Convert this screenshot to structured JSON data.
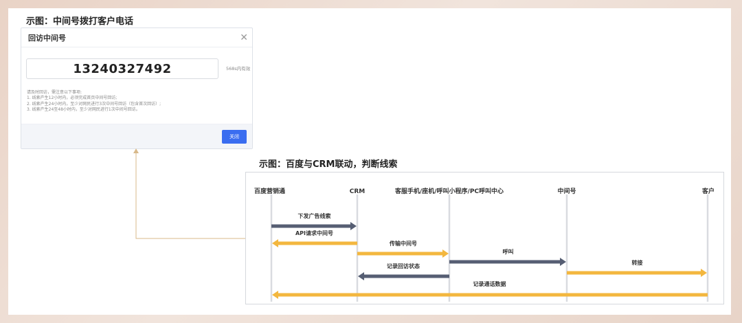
{
  "captions": {
    "top": "示图：中间号拨打客户电话",
    "bottom": "示图：百度与CRM联动，判断线索"
  },
  "dialog": {
    "title": "回访中间号",
    "close_icon": "close-icon",
    "phone_number": "13240327492",
    "validity": "568s内有效",
    "notes": [
      "请及时回访，需注意以下事项:",
      "1. 线索产生12小时内，必须完成首页中间号回访;",
      "2. 线索产生24小时内，至少对网民进行3次中间号回访（包含首次回访）;",
      "3. 线索产生24至48小时内，至少对网民进行1次中间号回访。"
    ],
    "close_label": "关闭",
    "accent_color": "#3a6df0"
  },
  "sequence": {
    "participants": [
      "百度营销通",
      "CRM",
      "客服手机/座机/呼叫小程序/PC呼叫中心",
      "中间号",
      "客户"
    ],
    "messages": [
      {
        "label": "下发广告线索",
        "from": 0,
        "to": 1,
        "color": "#565e73"
      },
      {
        "label": "API请求中间号",
        "from": 1,
        "to": 0,
        "color": "#f3b73f"
      },
      {
        "label": "传输中间号",
        "from": 1,
        "to": 2,
        "color": "#f3b73f"
      },
      {
        "label": "呼叫",
        "from": 2,
        "to": 3,
        "color": "#565e73"
      },
      {
        "label": "记录回访状态",
        "from": 2,
        "to": 1,
        "color": "#565e73"
      },
      {
        "label": "转接",
        "from": 3,
        "to": 4,
        "color": "#f3b73f"
      },
      {
        "label": "记录通话数据",
        "from": 4,
        "to": 0,
        "color": "#f3b73f"
      }
    ],
    "lifeline_color": "#d9dbe0"
  }
}
